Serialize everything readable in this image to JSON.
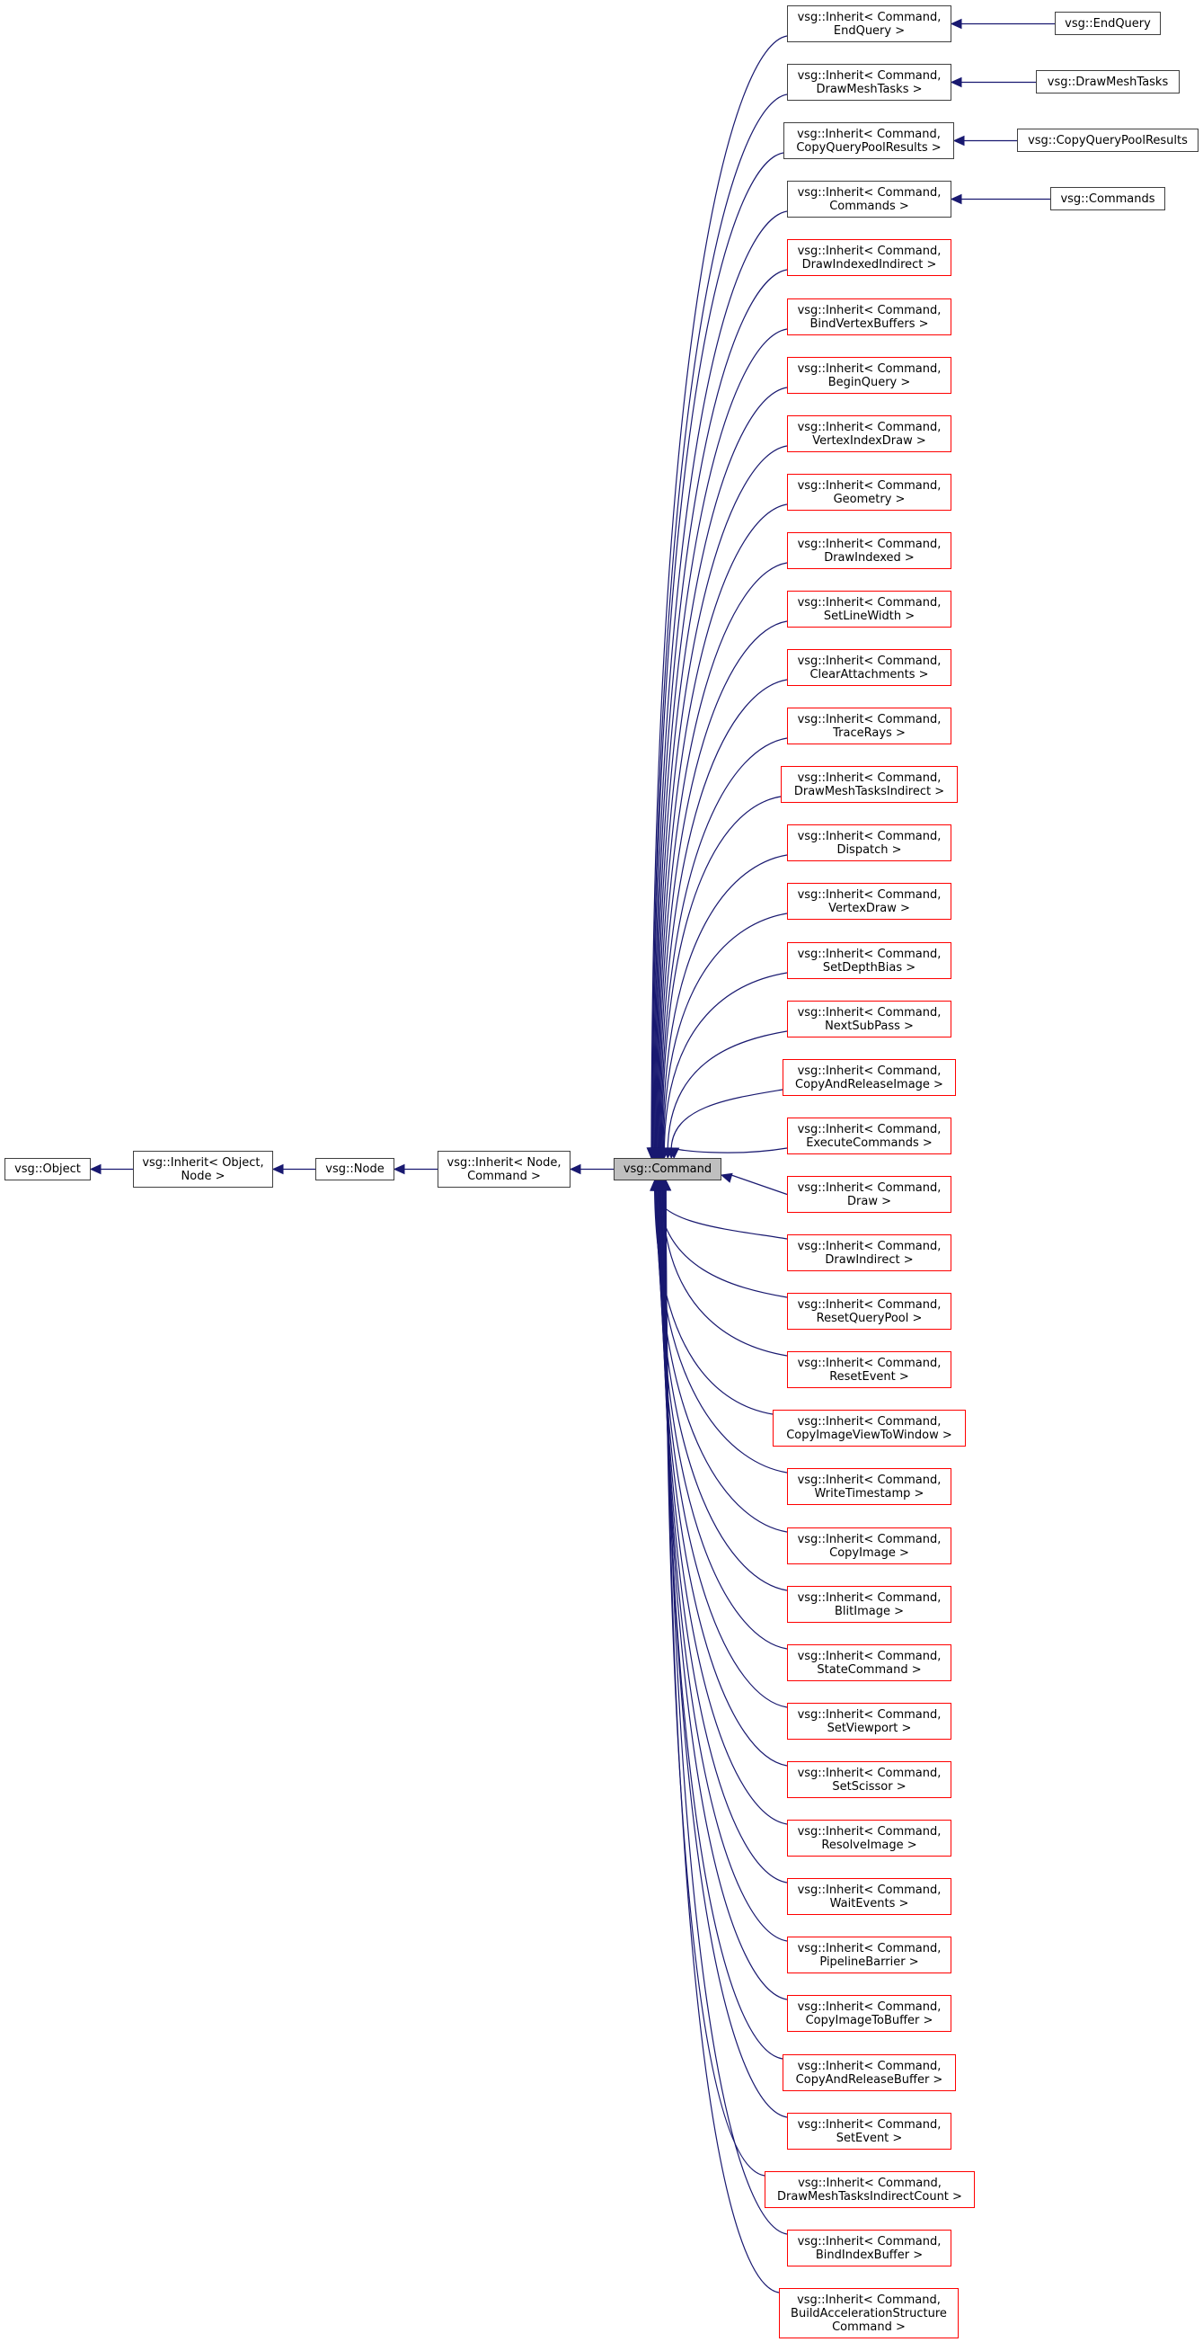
{
  "diagram": {
    "type": "class-inheritance-graph",
    "focus_node": "vsg::Command",
    "colors": {
      "edge": "#191970",
      "documented_border": "#404040",
      "truncated_border": "#ff0000",
      "focus_fill": "#bfbfbf",
      "node_fill": "#ffffff"
    },
    "ancestors": [
      {
        "id": "object",
        "lines": [
          "vsg::Object"
        ]
      },
      {
        "id": "inherit-object-node",
        "lines": [
          "vsg::Inherit< Object,",
          "Node >"
        ]
      },
      {
        "id": "node",
        "lines": [
          "vsg::Node"
        ]
      },
      {
        "id": "inherit-node-command",
        "lines": [
          "vsg::Inherit< Node,",
          "Command >"
        ]
      }
    ],
    "focus": {
      "id": "command",
      "lines": [
        "vsg::Command"
      ]
    },
    "children": [
      {
        "id": "endquery",
        "lines": [
          "vsg::Inherit< Command,",
          "EndQuery >"
        ],
        "truncated": false,
        "leaf": "vsg::EndQuery"
      },
      {
        "id": "drawmeshtasks",
        "lines": [
          "vsg::Inherit< Command,",
          "DrawMeshTasks >"
        ],
        "truncated": false,
        "leaf": "vsg::DrawMeshTasks"
      },
      {
        "id": "copyquerypoolresults",
        "lines": [
          "vsg::Inherit< Command,",
          "CopyQueryPoolResults >"
        ],
        "truncated": false,
        "leaf": "vsg::CopyQueryPoolResults"
      },
      {
        "id": "commands",
        "lines": [
          "vsg::Inherit< Command,",
          "Commands >"
        ],
        "truncated": false,
        "leaf": "vsg::Commands"
      },
      {
        "id": "drawindexedindirect",
        "lines": [
          "vsg::Inherit< Command,",
          "DrawIndexedIndirect >"
        ],
        "truncated": true
      },
      {
        "id": "bindvertexbuffers",
        "lines": [
          "vsg::Inherit< Command,",
          "BindVertexBuffers >"
        ],
        "truncated": true
      },
      {
        "id": "beginquery",
        "lines": [
          "vsg::Inherit< Command,",
          "BeginQuery >"
        ],
        "truncated": true
      },
      {
        "id": "vertexindexdraw",
        "lines": [
          "vsg::Inherit< Command,",
          "VertexIndexDraw >"
        ],
        "truncated": true
      },
      {
        "id": "geometry",
        "lines": [
          "vsg::Inherit< Command,",
          "Geometry >"
        ],
        "truncated": true
      },
      {
        "id": "drawindexed",
        "lines": [
          "vsg::Inherit< Command,",
          "DrawIndexed >"
        ],
        "truncated": true
      },
      {
        "id": "setlinewidth",
        "lines": [
          "vsg::Inherit< Command,",
          "SetLineWidth >"
        ],
        "truncated": true
      },
      {
        "id": "clearattachments",
        "lines": [
          "vsg::Inherit< Command,",
          "ClearAttachments >"
        ],
        "truncated": true
      },
      {
        "id": "tracerays",
        "lines": [
          "vsg::Inherit< Command,",
          "TraceRays >"
        ],
        "truncated": true
      },
      {
        "id": "drawmeshtasksindirect",
        "lines": [
          "vsg::Inherit< Command,",
          "DrawMeshTasksIndirect >"
        ],
        "truncated": true
      },
      {
        "id": "dispatch",
        "lines": [
          "vsg::Inherit< Command,",
          "Dispatch >"
        ],
        "truncated": true
      },
      {
        "id": "vertexdraw",
        "lines": [
          "vsg::Inherit< Command,",
          "VertexDraw >"
        ],
        "truncated": true
      },
      {
        "id": "setdepthbias",
        "lines": [
          "vsg::Inherit< Command,",
          "SetDepthBias >"
        ],
        "truncated": true
      },
      {
        "id": "nextsubpass",
        "lines": [
          "vsg::Inherit< Command,",
          "NextSubPass >"
        ],
        "truncated": true
      },
      {
        "id": "copyandreleaseimage",
        "lines": [
          "vsg::Inherit< Command,",
          "CopyAndReleaseImage >"
        ],
        "truncated": true
      },
      {
        "id": "executecommands",
        "lines": [
          "vsg::Inherit< Command,",
          "ExecuteCommands >"
        ],
        "truncated": true
      },
      {
        "id": "draw",
        "lines": [
          "vsg::Inherit< Command,",
          "Draw >"
        ],
        "truncated": true
      },
      {
        "id": "drawindirect",
        "lines": [
          "vsg::Inherit< Command,",
          "DrawIndirect >"
        ],
        "truncated": true
      },
      {
        "id": "resetquerypool",
        "lines": [
          "vsg::Inherit< Command,",
          "ResetQueryPool >"
        ],
        "truncated": true
      },
      {
        "id": "resetevent",
        "lines": [
          "vsg::Inherit< Command,",
          "ResetEvent >"
        ],
        "truncated": true
      },
      {
        "id": "copyimageviewtowindow",
        "lines": [
          "vsg::Inherit< Command,",
          "CopyImageViewToWindow >"
        ],
        "truncated": true
      },
      {
        "id": "writetimestamp",
        "lines": [
          "vsg::Inherit< Command,",
          "WriteTimestamp >"
        ],
        "truncated": true
      },
      {
        "id": "copyimage",
        "lines": [
          "vsg::Inherit< Command,",
          "CopyImage >"
        ],
        "truncated": true
      },
      {
        "id": "blitimage",
        "lines": [
          "vsg::Inherit< Command,",
          "BlitImage >"
        ],
        "truncated": true
      },
      {
        "id": "statecommand",
        "lines": [
          "vsg::Inherit< Command,",
          "StateCommand >"
        ],
        "truncated": true
      },
      {
        "id": "setviewport",
        "lines": [
          "vsg::Inherit< Command,",
          "SetViewport >"
        ],
        "truncated": true
      },
      {
        "id": "setscissor",
        "lines": [
          "vsg::Inherit< Command,",
          "SetScissor >"
        ],
        "truncated": true
      },
      {
        "id": "resolveimage",
        "lines": [
          "vsg::Inherit< Command,",
          "ResolveImage >"
        ],
        "truncated": true
      },
      {
        "id": "waitevents",
        "lines": [
          "vsg::Inherit< Command,",
          "WaitEvents >"
        ],
        "truncated": true
      },
      {
        "id": "pipelinebarrier",
        "lines": [
          "vsg::Inherit< Command,",
          "PipelineBarrier >"
        ],
        "truncated": true
      },
      {
        "id": "copyimagetobuffer",
        "lines": [
          "vsg::Inherit< Command,",
          "CopyImageToBuffer >"
        ],
        "truncated": true
      },
      {
        "id": "copyandreleasebuffer",
        "lines": [
          "vsg::Inherit< Command,",
          "CopyAndReleaseBuffer >"
        ],
        "truncated": true
      },
      {
        "id": "setevent",
        "lines": [
          "vsg::Inherit< Command,",
          "SetEvent >"
        ],
        "truncated": true
      },
      {
        "id": "drawmeshtasksindirectcount",
        "lines": [
          "vsg::Inherit< Command,",
          "DrawMeshTasksIndirectCount >"
        ],
        "truncated": true
      },
      {
        "id": "bindindexbuffer",
        "lines": [
          "vsg::Inherit< Command,",
          "BindIndexBuffer >"
        ],
        "truncated": true
      },
      {
        "id": "buildaccelerationstructurecommand",
        "lines": [
          "vsg::Inherit< Command,",
          "BuildAccelerationStructure",
          "Command >"
        ],
        "truncated": true
      }
    ]
  }
}
